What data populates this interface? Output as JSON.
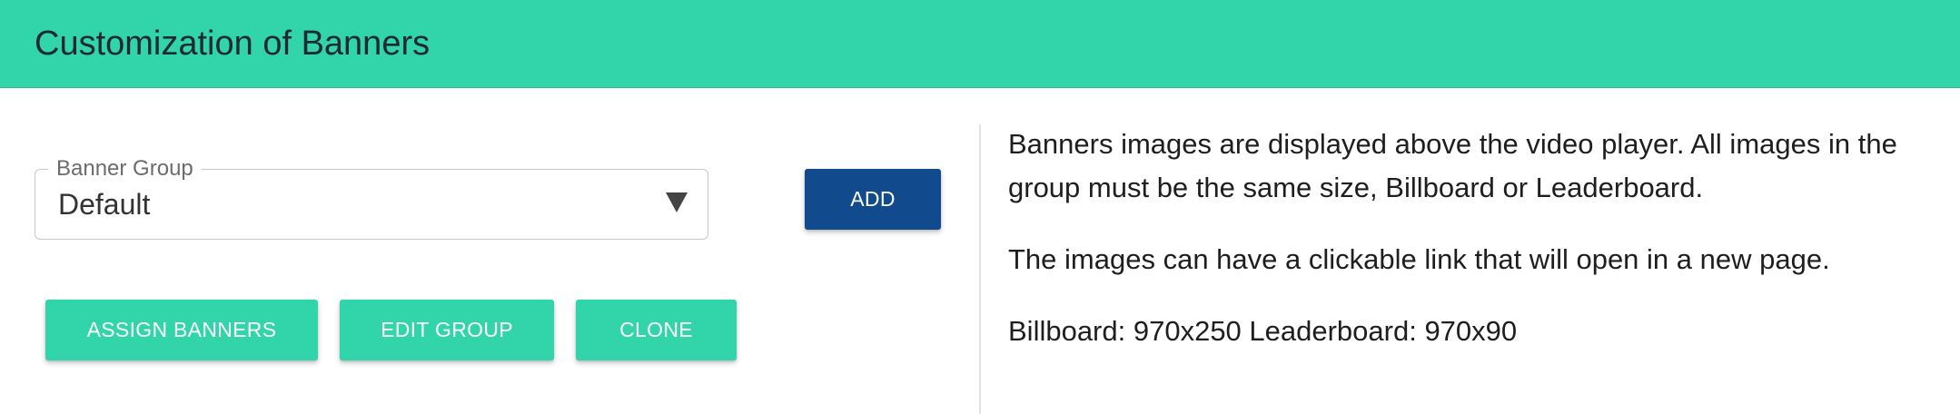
{
  "header": {
    "title": "Customization of Banners"
  },
  "banner_group": {
    "label": "Banner Group",
    "selected": "Default"
  },
  "buttons": {
    "add": "ADD",
    "assign_banners": "ASSIGN BANNERS",
    "edit_group": "EDIT GROUP",
    "clone": "CLONE"
  },
  "info": {
    "paragraph1": "Banners images are displayed above the video player. All images in the group must be the same size, Billboard or Leaderboard.",
    "paragraph2": "The images can have a clickable link that will open in a new page.",
    "paragraph3": "Billboard: 970x250 Leaderboard: 970x90"
  },
  "colors": {
    "header_bg": "#31d5a9",
    "add_button_bg": "#124a8e",
    "action_button_bg": "#31d5a9"
  },
  "icons": {
    "select_arrow": "triangle-down-icon"
  }
}
